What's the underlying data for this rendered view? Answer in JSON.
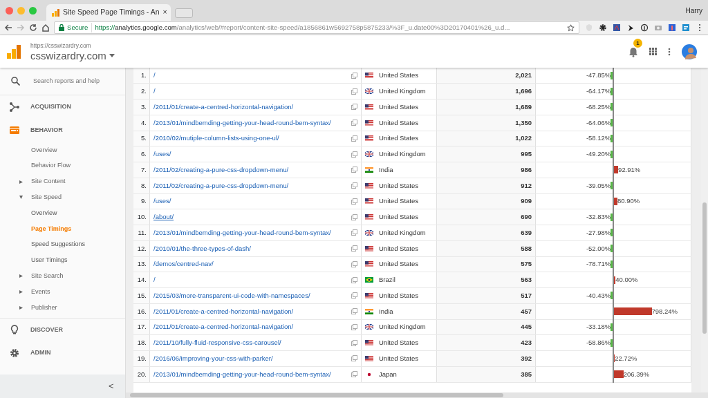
{
  "browser": {
    "tab": {
      "title": "Site Speed Page Timings - An",
      "close": "×"
    },
    "user": "Harry",
    "address": {
      "secure": "Secure",
      "protocol": "https://",
      "host": "analytics.google.com",
      "path": "/analytics/web/#report/content-site-speed/a1856861w5692758p5875233/%3F_u.date00%3D20170401%26_u.d..."
    }
  },
  "header": {
    "site_url": "https://csswizardry.com",
    "site_name": "csswizardry.com",
    "notifications": "1"
  },
  "sidebar": {
    "search_placeholder": "Search reports and help",
    "nav": [
      {
        "kind": "acquisition",
        "label": "ACQUISITION",
        "selected": false
      },
      {
        "kind": "behavior",
        "label": "BEHAVIOR",
        "selected": true,
        "children": [
          {
            "label": "Overview",
            "selected": false
          },
          {
            "label": "Behavior Flow",
            "selected": false
          },
          {
            "label": "Site Content",
            "selected": false,
            "expanded": false
          },
          {
            "label": "Site Speed",
            "selected": false,
            "expanded": true,
            "children": [
              {
                "label": "Overview",
                "selected": false
              },
              {
                "label": "Page Timings",
                "selected": true
              },
              {
                "label": "Speed Suggestions",
                "selected": false
              },
              {
                "label": "User Timings",
                "selected": false
              }
            ]
          },
          {
            "label": "Site Search",
            "selected": false,
            "expanded": false
          },
          {
            "label": "Events",
            "selected": false,
            "expanded": false
          },
          {
            "label": "Publisher",
            "selected": false,
            "expanded": false
          }
        ]
      },
      {
        "kind": "discover",
        "label": "DISCOVER",
        "selected": false
      },
      {
        "kind": "admin",
        "label": "ADMIN",
        "selected": false
      }
    ],
    "collapse": "<"
  },
  "table": {
    "rows": [
      {
        "kind": "down",
        "index": "1.",
        "page": "/",
        "hover": false,
        "flag": {
          "kind": "us"
        },
        "country": "United States",
        "sessions": "2,021",
        "change": "-47.85%",
        "level": 0.02
      },
      {
        "kind": "down",
        "index": "2.",
        "page": "/",
        "hover": false,
        "flag": {
          "kind": "gb"
        },
        "country": "United Kingdom",
        "sessions": "1,696",
        "change": "-64.17%",
        "level": 0.02
      },
      {
        "kind": "down",
        "index": "3.",
        "page": "/2011/01/create-a-centred-horizontal-navigation/",
        "hover": false,
        "flag": {
          "kind": "us"
        },
        "country": "United States",
        "sessions": "1,689",
        "change": "-68.25%",
        "level": 0.02
      },
      {
        "kind": "down",
        "index": "4.",
        "page": "/2013/01/mindbemding-getting-your-head-round-bem-syntax/",
        "hover": false,
        "flag": {
          "kind": "us"
        },
        "country": "United States",
        "sessions": "1,350",
        "change": "-64.06%",
        "level": 0.02
      },
      {
        "kind": "down",
        "index": "5.",
        "page": "/2010/02/mutiple-column-lists-using-one-ul/",
        "hover": false,
        "flag": {
          "kind": "us"
        },
        "country": "United States",
        "sessions": "1,022",
        "change": "-58.12%",
        "level": 0.02
      },
      {
        "kind": "down",
        "index": "6.",
        "page": "/uses/",
        "hover": false,
        "flag": {
          "kind": "gb"
        },
        "country": "United Kingdom",
        "sessions": "995",
        "change": "-49.20%",
        "level": 0.02
      },
      {
        "kind": "up",
        "index": "7.",
        "page": "/2011/02/creating-a-pure-css-dropdown-menu/",
        "hover": false,
        "flag": {
          "kind": "in"
        },
        "country": "India",
        "sessions": "986",
        "change": "92.91%",
        "level": 0.06
      },
      {
        "kind": "down",
        "index": "8.",
        "page": "/2011/02/creating-a-pure-css-dropdown-menu/",
        "hover": false,
        "flag": {
          "kind": "us"
        },
        "country": "United States",
        "sessions": "912",
        "change": "-39.05%",
        "level": 0.02
      },
      {
        "kind": "up",
        "index": "9.",
        "page": "/uses/",
        "hover": false,
        "flag": {
          "kind": "us"
        },
        "country": "United States",
        "sessions": "909",
        "change": "80.90%",
        "level": 0.05
      },
      {
        "kind": "down",
        "index": "10.",
        "page": "/about/",
        "hover": true,
        "flag": {
          "kind": "us"
        },
        "country": "United States",
        "sessions": "690",
        "change": "-32.83%",
        "level": 0.02
      },
      {
        "kind": "down",
        "index": "11.",
        "page": "/2013/01/mindbemding-getting-your-head-round-bem-syntax/",
        "hover": false,
        "flag": {
          "kind": "gb"
        },
        "country": "United Kingdom",
        "sessions": "639",
        "change": "-27.98%",
        "level": 0.02
      },
      {
        "kind": "down",
        "index": "12.",
        "page": "/2010/01/the-three-types-of-dash/",
        "hover": false,
        "flag": {
          "kind": "us"
        },
        "country": "United States",
        "sessions": "588",
        "change": "-52.00%",
        "level": 0.02
      },
      {
        "kind": "down",
        "index": "13.",
        "page": "/demos/centred-nav/",
        "hover": false,
        "flag": {
          "kind": "us"
        },
        "country": "United States",
        "sessions": "575",
        "change": "-78.71%",
        "level": 0.02
      },
      {
        "kind": "up",
        "index": "14.",
        "page": "/",
        "hover": false,
        "flag": {
          "kind": "br"
        },
        "country": "Brazil",
        "sessions": "563",
        "change": "40.00%",
        "level": 0.025
      },
      {
        "kind": "down",
        "index": "15.",
        "page": "/2015/03/more-transparent-ui-code-with-namespaces/",
        "hover": false,
        "flag": {
          "kind": "us"
        },
        "country": "United States",
        "sessions": "517",
        "change": "-40.43%",
        "level": 0.02
      },
      {
        "kind": "up",
        "index": "16.",
        "page": "/2011/01/create-a-centred-horizontal-navigation/",
        "hover": false,
        "flag": {
          "kind": "in"
        },
        "country": "India",
        "sessions": "457",
        "change": "798.24%",
        "level": 0.5
      },
      {
        "kind": "down",
        "index": "17.",
        "page": "/2011/01/create-a-centred-horizontal-navigation/",
        "hover": false,
        "flag": {
          "kind": "gb"
        },
        "country": "United Kingdom",
        "sessions": "445",
        "change": "-33.18%",
        "level": 0.02
      },
      {
        "kind": "down",
        "index": "18.",
        "page": "/2011/10/fully-fluid-responsive-css-carousel/",
        "hover": false,
        "flag": {
          "kind": "us"
        },
        "country": "United States",
        "sessions": "423",
        "change": "-58.86%",
        "level": 0.02
      },
      {
        "kind": "up",
        "index": "19.",
        "page": "/2016/06/improving-your-css-with-parker/",
        "hover": false,
        "flag": {
          "kind": "us"
        },
        "country": "United States",
        "sessions": "392",
        "change": "22.72%",
        "level": 0.015
      },
      {
        "kind": "up",
        "index": "20.",
        "page": "/2013/01/mindbemding-getting-your-head-round-bem-syntax/",
        "hover": false,
        "flag": {
          "kind": "jp"
        },
        "country": "Japan",
        "sessions": "385",
        "change": "206.39%",
        "level": 0.13
      }
    ]
  }
}
